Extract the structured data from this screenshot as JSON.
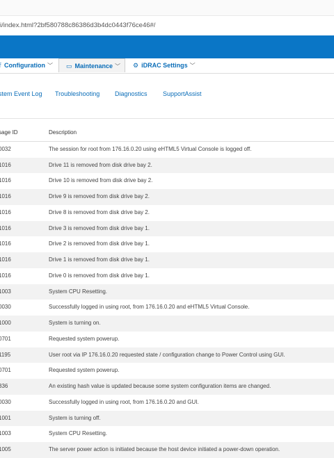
{
  "browser": {
    "url": "i/index.html?2bf580788c86386d3b4dc0443f76ce46#/"
  },
  "top_menu": {
    "configuration": "Configuration",
    "maintenance": "Maintenance",
    "idrac_settings": "iDRAC Settings"
  },
  "sub_nav": {
    "items": [
      "stem Event Log",
      "Troubleshooting",
      "Diagnostics",
      "SupportAssist"
    ]
  },
  "table": {
    "headers": {
      "message_id": "sage ID",
      "description": "Description"
    },
    "rows": [
      {
        "id": "0032",
        "desc": "The session for root from 176.16.0.20 using eHTML5 Virtual Console is logged off."
      },
      {
        "id": "1016",
        "desc": "Drive 11 is removed from disk drive bay 2."
      },
      {
        "id": "1016",
        "desc": "Drive 10 is removed from disk drive bay 2."
      },
      {
        "id": "1016",
        "desc": "Drive 9 is removed from disk drive bay 2."
      },
      {
        "id": "1016",
        "desc": "Drive 8 is removed from disk drive bay 2."
      },
      {
        "id": "1016",
        "desc": "Drive 3 is removed from disk drive bay 1."
      },
      {
        "id": "1016",
        "desc": "Drive 2 is removed from disk drive bay 1."
      },
      {
        "id": "1016",
        "desc": "Drive 1 is removed from disk drive bay 1."
      },
      {
        "id": "1016",
        "desc": "Drive 0 is removed from disk drive bay 1."
      },
      {
        "id": "1003",
        "desc": "System CPU Resetting."
      },
      {
        "id": "0030",
        "desc": "Successfully logged in using root, from 176.16.0.20 and eHTML5 Virtual Console."
      },
      {
        "id": "1000",
        "desc": "System is turning on."
      },
      {
        "id": "0701",
        "desc": "Requested system powerup."
      },
      {
        "id": "1195",
        "desc": "User root via IP 176.16.0.20 requested state / configuration change to Power Control using GUI."
      },
      {
        "id": "0701",
        "desc": "Requested system powerup."
      },
      {
        "id": "336",
        "desc": "An existing hash value is updated because some system configuration items are changed."
      },
      {
        "id": "0030",
        "desc": "Successfully logged in using root, from 176.16.0.20 and GUI."
      },
      {
        "id": "1001",
        "desc": "System is turning off."
      },
      {
        "id": "1003",
        "desc": "System CPU Resetting."
      },
      {
        "id": "1005",
        "desc": "The server power action is initiated because the host device initiated a power-down operation."
      }
    ]
  },
  "colors": {
    "banner": "#0a76c6",
    "link": "#0a6db8"
  }
}
